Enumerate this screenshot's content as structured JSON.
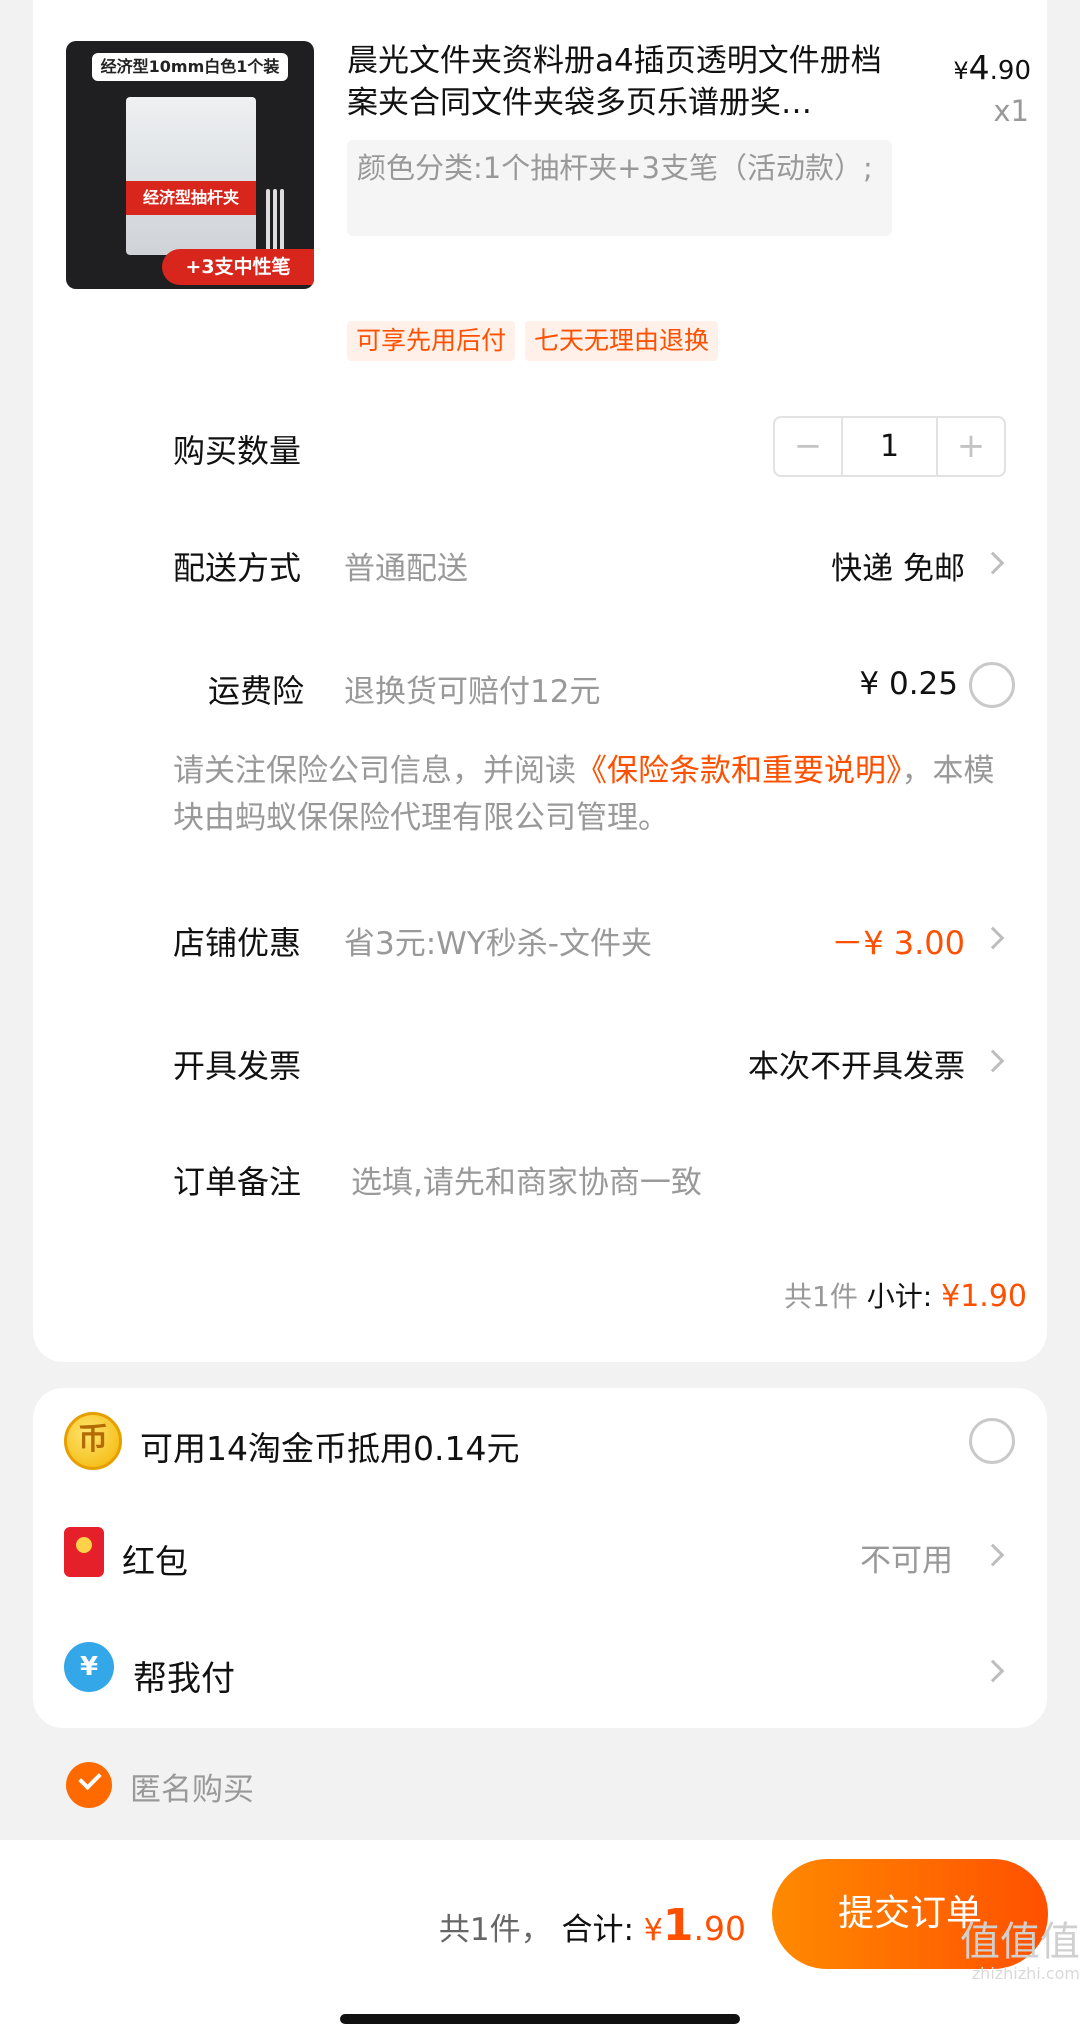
{
  "product": {
    "image_tag": "经济型10mm白色1个装",
    "image_band": "经济型抽杆夹",
    "image_pen_tag": "+3支中性笔",
    "title": "晨光文件夹资料册a4插页透明文件册档案夹合同文件夹袋多页乐谱册奖…",
    "price_currency": "¥",
    "price_int": "4",
    "price_dec": ".90",
    "quantity": "x1",
    "sku": "颜色分类:1个抽杆夹+3支笔（活动款）;",
    "tags": [
      "可享先用后付",
      "七天无理由退换"
    ]
  },
  "rows": {
    "quantity": {
      "label": "购买数量",
      "value": "1",
      "minus": "−",
      "plus": "+"
    },
    "delivery": {
      "label": "配送方式",
      "sub": "普通配送",
      "value": "快递 免邮"
    },
    "insurance": {
      "label": "运费险",
      "sub": "退换货可赔付12元",
      "value": "¥ 0.25"
    },
    "insurance_notice": {
      "pre": "请关注保险公司信息，并阅读",
      "link": "《保险条款和重要说明》",
      "post": "，本模块由蚂蚁保保险代理有限公司管理。"
    },
    "shop_discount": {
      "label": "店铺优惠",
      "sub": "省3元:WY秒杀-文件夹",
      "value": "－¥ 3.00"
    },
    "invoice": {
      "label": "开具发票",
      "value": "本次不开具发票"
    },
    "remark": {
      "label": "订单备注",
      "placeholder": "选填,请先和商家协商一致"
    },
    "subtotal": {
      "count": "共1件",
      "label": "小计:",
      "currency": "¥",
      "int": "1",
      "dec": ".90"
    }
  },
  "payment": {
    "coins": {
      "icon": "coin-icon",
      "label": "可用14淘金币抵用0.14元"
    },
    "redpack": {
      "icon": "red-envelope-icon",
      "label": "红包",
      "value": "不可用"
    },
    "helppay": {
      "icon": "help-pay-icon",
      "label": "帮我付"
    }
  },
  "anonymous": {
    "label": "匿名购买",
    "checked": true
  },
  "footer": {
    "count": "共1件，",
    "total_label": "合计:",
    "currency": "¥",
    "int": "1",
    "dec": ".90",
    "submit_label": "提交订单",
    "watermark_line1": "值值值",
    "watermark_line2": "zhizhizhi.com"
  },
  "colors": {
    "accent": "#ff5000",
    "tag_bg": "#fff1e9",
    "page_bg": "#f2f2f2"
  }
}
